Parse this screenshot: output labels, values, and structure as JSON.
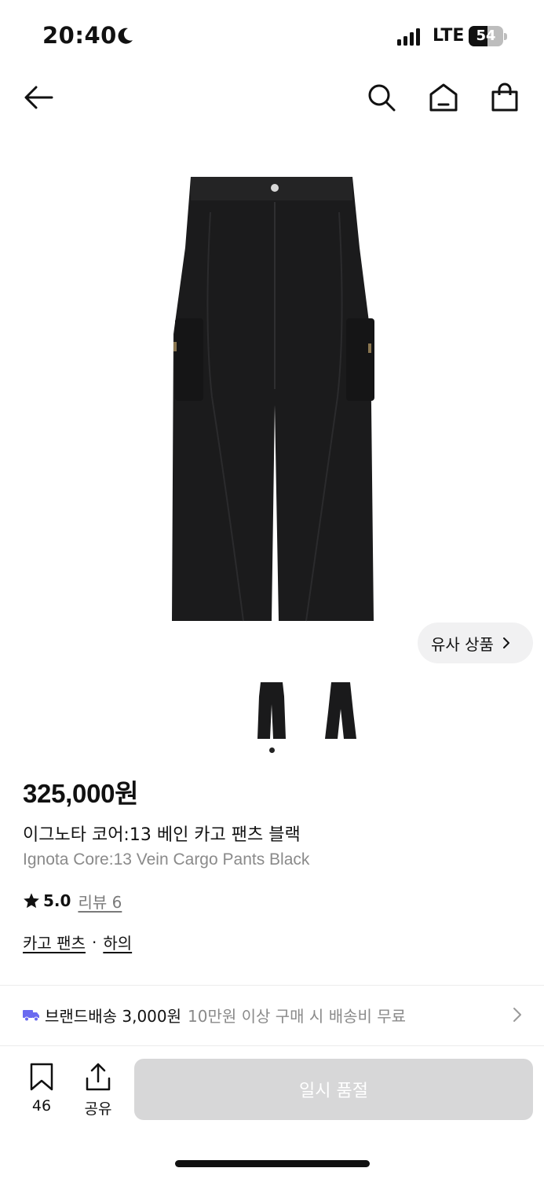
{
  "status_bar": {
    "time": "20:40",
    "network": "LTE",
    "battery_level": "54",
    "battery_fraction": 0.54,
    "icons": [
      "moon-icon",
      "signal-icon",
      "battery-icon"
    ]
  },
  "nav": {
    "icons": [
      "back-arrow-icon",
      "search-icon",
      "home-icon",
      "shopping-bag-icon"
    ]
  },
  "gallery": {
    "similar_label": "유사 상품",
    "thumbnail_count": 2,
    "current_page": 1
  },
  "product": {
    "price": "325,000원",
    "name_ko": "이그노타 코어:13 베인 카고 팬츠 블랙",
    "name_en": "Ignota Core:13 Vein Cargo Pants Black",
    "rating": "5.0",
    "review_label": "리뷰 6",
    "categories": [
      "카고 팬츠",
      "하의"
    ],
    "category_separator": "·"
  },
  "shipping": {
    "label": "브랜드배송 3,000원",
    "note": "10만원 이상 구매 시 배송비 무료",
    "icon": "truck-icon",
    "icon_color": "#6a6af0"
  },
  "bottom_bar": {
    "bookmark_count": "46",
    "share_label": "공유",
    "buy_label": "일시 품절",
    "buy_color": "#d7d7d8"
  }
}
